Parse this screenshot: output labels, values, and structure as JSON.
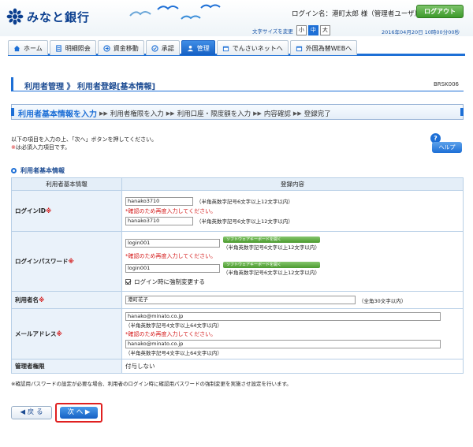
{
  "header": {
    "bank_name": "みなと銀行",
    "user_info": "ログイン名：港町太郎 様（管理者ユーザ）",
    "logout_label": "ログアウト",
    "font_size_label": "文字サイズを変更",
    "font_sizes": [
      "小",
      "中",
      "大"
    ],
    "font_size_selected": "中",
    "datetime": "2016年04月20日 10時00分00秒"
  },
  "nav": {
    "tabs": [
      {
        "label": "ホーム",
        "icon": "home-icon"
      },
      {
        "label": "明細照会",
        "icon": "document-icon"
      },
      {
        "label": "資金移動",
        "icon": "transfer-icon"
      },
      {
        "label": "承認",
        "icon": "check-icon"
      },
      {
        "label": "管理",
        "icon": "users-icon",
        "active": true
      },
      {
        "label": "でんさいネットへ",
        "icon": "external-icon"
      },
      {
        "label": "外国為替WEBへ",
        "icon": "external-icon"
      }
    ]
  },
  "page": {
    "title": "利用者管理 》 利用者登録[基本情報]",
    "page_id": "BRSK006"
  },
  "steps": [
    {
      "label": "利用者基本情報を入力",
      "current": true
    },
    {
      "label": "利用者権限を入力"
    },
    {
      "label": "利用口座・限度額を入力"
    },
    {
      "label": "内容確認"
    },
    {
      "label": "登録完了"
    }
  ],
  "instructions": {
    "line1": "以下の項目を入力の上、「次へ」ボタンを押してください。",
    "req_mark": "※",
    "line2": "は必須入力項目です。",
    "help_label": "ヘルプ"
  },
  "section": {
    "title": "利用者基本情報"
  },
  "table": {
    "header_left": "利用者基本情報",
    "header_right": "登録内容",
    "req": "※",
    "login_id": {
      "label": "ログインID",
      "value": "hanako3710",
      "hint": "（半角英数字記号6文字以上12文字以内）",
      "warn": "*確認のため再度入力してください。",
      "confirm_value": "hanako3710",
      "confirm_hint": "（半角英数字記号6文字以上12文字以内）"
    },
    "password": {
      "label": "ログインパスワード",
      "value": "login001",
      "skb_label": "ソフトウェアキーボードを開く",
      "hint": "（半角英数字記号6文字以上12文字以内）",
      "warn": "*確認のため再度入力してください。",
      "confirm_value": "login001",
      "confirm_hint": "（半角英数字記号6文字以上12文字以内）",
      "force_change_label": "ログイン時に強制変更する"
    },
    "user_name": {
      "label": "利用者名",
      "value": "港町花子",
      "hint": "（全角30文字以内）"
    },
    "email": {
      "label": "メールアドレス",
      "value": "hanako@minato.co.jp",
      "hint": "（半角英数字記号4文字以上64文字以内）",
      "warn": "*確認のため再度入力してください。",
      "confirm_value": "hanako@minato.co.jp",
      "confirm_hint": "（半角英数字記号4文字以上64文字以内）"
    },
    "admin": {
      "label": "管理者権限",
      "value": "付与しない"
    }
  },
  "note": "※確認用パスワードの設定が必要な場合、利用者のログイン時に確認用パスワードの強制変更を実施させ設定を行います。",
  "buttons": {
    "back_label": "◀ 戻 る",
    "next_label": "次 へ ▶"
  },
  "colors": {
    "accent": "#1d6fd6",
    "required": "#d41a1a",
    "logout": "#3d9a2b"
  }
}
